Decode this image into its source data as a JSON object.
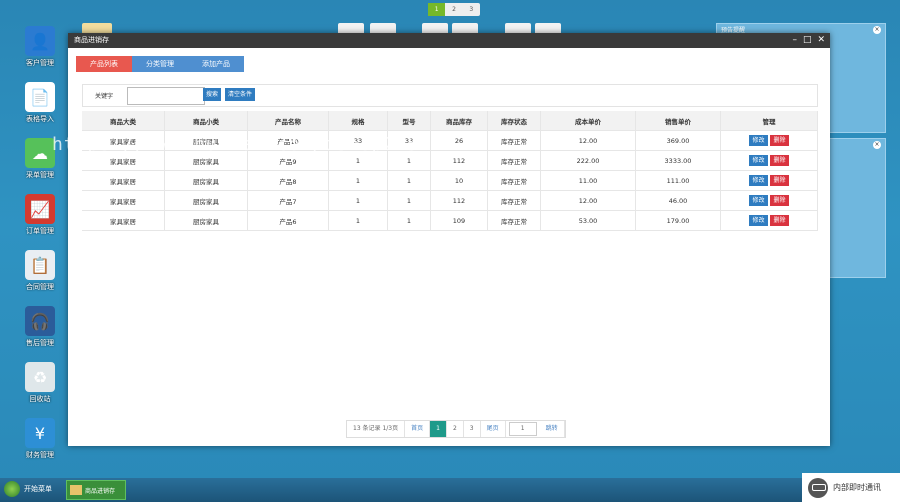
{
  "desktop": {
    "icons": [
      {
        "label": "客户管理",
        "icon": "customer-icon",
        "color": "#2b7bd1"
      },
      {
        "label": "表格导入",
        "icon": "document-icon",
        "color": "#ffffff"
      },
      {
        "label": "采单管理",
        "icon": "cloud-icon",
        "color": "#56c15a"
      },
      {
        "label": "订单管理",
        "icon": "chart-icon",
        "color": "#d43a2f"
      },
      {
        "label": "合同管理",
        "icon": "contract-icon",
        "color": "#e9eef3"
      },
      {
        "label": "售后管理",
        "icon": "service-icon",
        "color": "#2b5c9a"
      },
      {
        "label": "回收站",
        "icon": "recycle-bin-icon",
        "color": "#dfe7ea"
      },
      {
        "label": "财务管理",
        "icon": "finance-icon",
        "color": "#2d8fd5"
      }
    ],
    "pager": [
      "1",
      "2",
      "3"
    ],
    "widget_title": "预告提醒"
  },
  "window": {
    "title": "商品进销存",
    "tabs": [
      "产品列表",
      "分类管理",
      "添加产品"
    ]
  },
  "search": {
    "label": "关键字",
    "value": "",
    "search_button": "搜索",
    "clear_button": "清空条件"
  },
  "table": {
    "headers": [
      "商品大类",
      "商品小类",
      "产品名称",
      "规格",
      "型号",
      "商品库存",
      "库存状态",
      "成本单价",
      "销售单价",
      "管理"
    ],
    "rows": [
      {
        "cat": "家具家居",
        "sub": "厨房厨具",
        "name": "产品10",
        "spec": "33",
        "model": "33",
        "stock": "26",
        "status": "库存正常",
        "cost": "12.00",
        "price": "369.00"
      },
      {
        "cat": "家具家居",
        "sub": "厨房家具",
        "name": "产品9",
        "spec": "1",
        "model": "1",
        "stock": "112",
        "status": "库存正常",
        "cost": "222.00",
        "price": "3333.00"
      },
      {
        "cat": "家具家居",
        "sub": "厨房家具",
        "name": "产品8",
        "spec": "1",
        "model": "1",
        "stock": "10",
        "status": "库存正常",
        "cost": "11.00",
        "price": "111.00"
      },
      {
        "cat": "家具家居",
        "sub": "厨房家具",
        "name": "产品7",
        "spec": "1",
        "model": "1",
        "stock": "112",
        "status": "库存正常",
        "cost": "12.00",
        "price": "46.00"
      },
      {
        "cat": "家具家居",
        "sub": "厨房家具",
        "name": "产品6",
        "spec": "1",
        "model": "1",
        "stock": "109",
        "status": "库存正常",
        "cost": "53.00",
        "price": "179.00"
      }
    ],
    "edit_label": "修改",
    "delete_label": "删除"
  },
  "pagination": {
    "summary": "13 条记录 1/3页",
    "prev": "首页",
    "pages": [
      "1",
      "2",
      "3"
    ],
    "last": "尾页",
    "jump_value": "1",
    "go": "跳转"
  },
  "watermark": "https://www.huzhan.com/ishop22512",
  "taskbar": {
    "start_label": "开始菜单",
    "task_label": "商品进销存",
    "im_label": "内部即时通讯"
  }
}
